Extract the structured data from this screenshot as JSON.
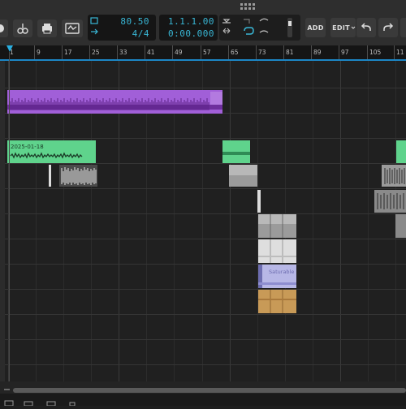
{
  "transport": {
    "tempo": "80.50",
    "time_signature": "4/4",
    "position_bars": "1.1.1.00",
    "position_time": "0:00.000"
  },
  "toolbar": {
    "add_label": "ADD",
    "edit_label": "EDIT"
  },
  "ruler": {
    "ticks": [
      "1",
      "9",
      "17",
      "25",
      "33",
      "41",
      "49",
      "57",
      "65",
      "73",
      "81",
      "89",
      "97",
      "105",
      "11"
    ]
  },
  "clips": {
    "audio_clip_label": "2025-01-18",
    "blue_clip_label": "Saturable"
  },
  "colors": {
    "accent": "#39b7d6",
    "playhead": "#1c86c6",
    "purple_clip": "#a15fd8",
    "green_clip": "#5fd38c",
    "gray_clip": "#9b9b9b",
    "light_clip": "#dedede",
    "blue_clip": "#b7b7e6",
    "orange_clip": "#c89a57"
  }
}
